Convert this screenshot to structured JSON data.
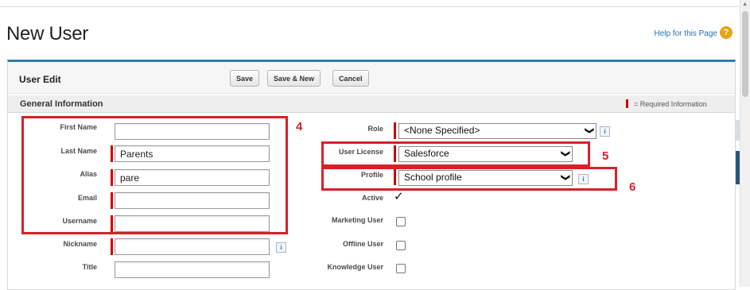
{
  "page": {
    "title": "New User",
    "help_link": "Help for this Page",
    "help_icon": "?"
  },
  "panel": {
    "title": "User Edit",
    "buttons": {
      "save": "Save",
      "save_new": "Save & New",
      "cancel": "Cancel"
    }
  },
  "section": {
    "title": "General Information",
    "required_legend": "= Required Information"
  },
  "left_fields": {
    "first_name": {
      "label": "First Name",
      "value": ""
    },
    "last_name": {
      "label": "Last Name",
      "value": "Parents"
    },
    "alias": {
      "label": "Alias",
      "value": "pare"
    },
    "email": {
      "label": "Email",
      "value": ""
    },
    "username": {
      "label": "Username",
      "value": ""
    },
    "nickname": {
      "label": "Nickname",
      "value": ""
    },
    "title": {
      "label": "Title",
      "value": ""
    }
  },
  "right_fields": {
    "role": {
      "label": "Role",
      "selected": "<None Specified>"
    },
    "user_license": {
      "label": "User License",
      "selected": "Salesforce"
    },
    "profile": {
      "label": "Profile",
      "selected": "School profile"
    },
    "active": {
      "label": "Active",
      "checked": true
    },
    "marketing_user": {
      "label": "Marketing User",
      "checked": false
    },
    "offline_user": {
      "label": "Offline User",
      "checked": false
    },
    "knowledge_user": {
      "label": "Knowledge User",
      "checked": false
    }
  },
  "annotations": {
    "box_4": "4",
    "box_5": "5",
    "box_6": "6"
  },
  "glyphs": {
    "info": "i",
    "chevron": "❯",
    "check": "✓",
    "scroll_up": "▲"
  },
  "colors": {
    "accent": "#2f7da8",
    "required": "#cc0000",
    "annotation": "#d8202a",
    "side_tab": "#24587a"
  }
}
